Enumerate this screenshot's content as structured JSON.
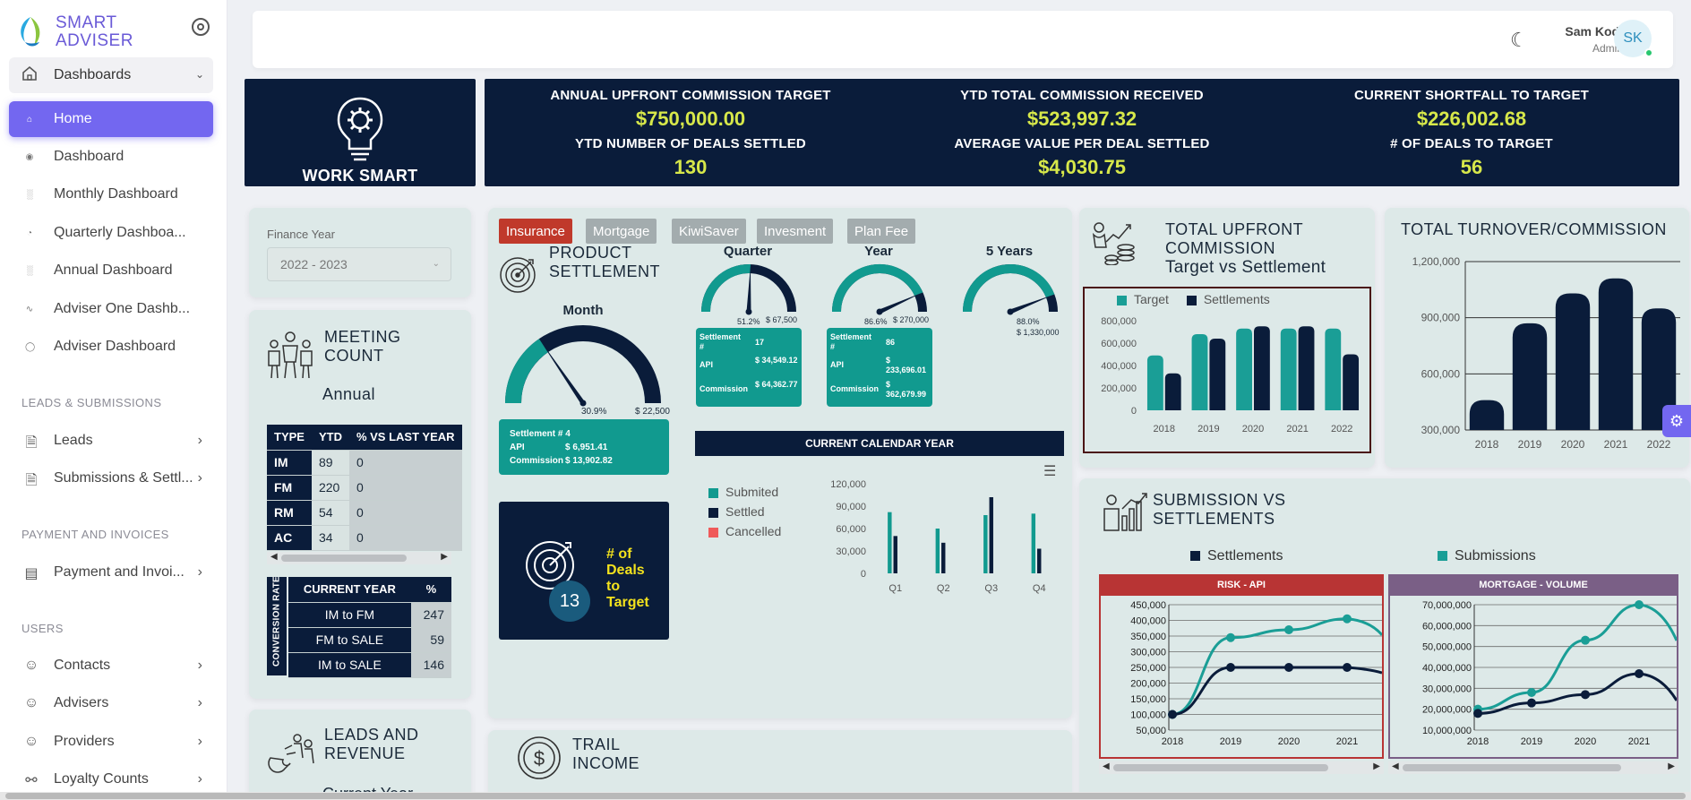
{
  "brand": {
    "line1": "SMART",
    "line2": "ADVISER"
  },
  "sidebar": {
    "group": "Dashboards",
    "items": [
      {
        "label": "Home"
      },
      {
        "label": "Dashboard"
      },
      {
        "label": "Monthly Dashboard"
      },
      {
        "label": "Quarterly Dashboa..."
      },
      {
        "label": "Annual Dashboard"
      },
      {
        "label": "Adviser One Dashb..."
      },
      {
        "label": "Adviser Dashboard"
      }
    ],
    "sections": {
      "leads": "LEADS & SUBMISSIONS",
      "payment": "PAYMENT AND INVOICES",
      "users": "USERS"
    },
    "leads_items": [
      "Leads",
      "Submissions & Settl..."
    ],
    "payment_items": [
      "Payment and Invoi..."
    ],
    "user_items": [
      "Contacts",
      "Advisers",
      "Providers",
      "Loyalty Counts"
    ]
  },
  "header": {
    "user_name": "Sam Kodi",
    "user_role": "Admin",
    "initials": "SK"
  },
  "work_smart": {
    "caption": "WORK SMART"
  },
  "kpis": [
    {
      "label": "ANNUAL UPFRONT COMMISSION TARGET",
      "value": "$750,000.00"
    },
    {
      "label": "YTD TOTAL COMMISSION RECEIVED",
      "value": "$523,997.32"
    },
    {
      "label": "CURRENT SHORTFALL TO TARGET",
      "value": "$226,002.68"
    },
    {
      "label": "YTD NUMBER OF DEALS SETTLED",
      "value": "130"
    },
    {
      "label": "AVERAGE VALUE PER DEAL SETTLED",
      "value": "$4,030.75"
    },
    {
      "label": "# OF DEALS TO TARGET",
      "value": "56"
    }
  ],
  "finance": {
    "label": "Finance Year",
    "value": "2022 - 2023"
  },
  "meeting": {
    "title_l1": "MEETING",
    "title_l2": "COUNT",
    "subtitle": "Annual",
    "headers": [
      "TYPE",
      "YTD",
      "% VS LAST YEAR"
    ],
    "rows": [
      [
        "IM",
        "89",
        "0"
      ],
      [
        "FM",
        "220",
        "0"
      ],
      [
        "RM",
        "54",
        "0"
      ],
      [
        "AC",
        "34",
        "0"
      ]
    ],
    "conv_label": "CONVERSION RATE",
    "conv_headers": [
      "CURRENT YEAR",
      "%"
    ],
    "conv_rows": [
      [
        "IM to FM",
        "247"
      ],
      [
        "FM to SALE",
        "59"
      ],
      [
        "IM to SALE",
        "146"
      ]
    ]
  },
  "leads_revenue": {
    "title_l1": "LEADS AND",
    "title_l2": "REVENUE",
    "subtitle": "Current Year"
  },
  "product": {
    "tabs": [
      "Insurance",
      "Mortgage",
      "KiwiSaver",
      "Invesment",
      "Plan Fee"
    ],
    "title_l1": "PRODUCT",
    "title_l2": "SETTLEMENT",
    "month": {
      "label": "Month",
      "pct": "30.9%",
      "target": "$ 22,500",
      "fraction": 0.309,
      "settlement": "Settlement # 4",
      "api_label": "API",
      "api": "$ 6,951.41",
      "comm_label": "Commission",
      "comm": "$ 13,902.82"
    },
    "quarter": {
      "label": "Quarter",
      "pct": "51.2%",
      "target": "$ 67,500",
      "fraction": 0.512,
      "settlement_label": "Settlement #",
      "settlement": "17",
      "api_label": "API",
      "api": "$ 34,549.12",
      "comm_label": "Commission",
      "comm": "$ 64,362.77"
    },
    "year": {
      "label": "Year",
      "pct": "86.6%",
      "target": "$ 270,000",
      "fraction": 0.866,
      "settlement_label": "Settlement #",
      "settlement": "86",
      "api_label": "API",
      "api": "$ 233,696.01",
      "comm_label": "Commission",
      "comm": "$ 362,679.99"
    },
    "five": {
      "label": "5 Years",
      "pct": "88.0%",
      "target": "$ 1,330,000",
      "fraction": 0.88
    },
    "deals": {
      "count": "13",
      "l1": "# of",
      "l2": "Deals",
      "l3": "to",
      "l4": "Target"
    },
    "calendar_title": "CURRENT CALENDAR YEAR",
    "calendar_legend": [
      "Submited",
      "Settled",
      "Cancelled"
    ]
  },
  "trail": {
    "title_l1": "TRAIL",
    "title_l2": "INCOME"
  },
  "upfront": {
    "title_l1": "TOTAL UPFRONT",
    "title_l2": "COMMISSION",
    "title_l3": "Target vs Settlement",
    "legend": [
      "Target",
      "Settlements"
    ]
  },
  "turnover": {
    "title": "TOTAL TURNOVER/COMMISSION"
  },
  "subs": {
    "title_l1": "SUBMISSION VS",
    "title_l2": "SETTLEMENTS",
    "legend": [
      "Settlements",
      "Submissions"
    ],
    "risk_title": "RISK - API",
    "mortgage_title": "MORTGAGE - VOLUME"
  },
  "colors": {
    "navy": "#0a1c3a",
    "teal": "#1a9e96",
    "accent": "#7367f0",
    "yellow": "#d7e84a",
    "red": "#c0392b",
    "purple": "#7a5f86"
  },
  "chart_data": [
    {
      "type": "bar",
      "title": "CURRENT CALENDAR YEAR",
      "categories": [
        "Q1",
        "Q2",
        "Q3",
        "Q4"
      ],
      "series": [
        {
          "name": "Submited",
          "values": [
            82000,
            60000,
            78000,
            80000
          ]
        },
        {
          "name": "Settled",
          "values": [
            50000,
            41000,
            102000,
            33000
          ]
        },
        {
          "name": "Cancelled",
          "values": [
            0,
            0,
            0,
            0
          ]
        }
      ],
      "ylim": [
        0,
        120000
      ],
      "yticks": [
        "120,000",
        "90,000",
        "60,000",
        "30,000",
        "0"
      ]
    },
    {
      "type": "bar",
      "title": "TOTAL UPFRONT COMMISSION Target vs Settlement",
      "categories": [
        "2018",
        "2019",
        "2020",
        "2021",
        "2022"
      ],
      "series": [
        {
          "name": "Target",
          "values": [
            490000,
            680000,
            730000,
            730000,
            730000
          ]
        },
        {
          "name": "Settlements",
          "values": [
            330000,
            640000,
            750000,
            750000,
            500000
          ]
        }
      ],
      "ylim": [
        0,
        800000
      ],
      "yticks": [
        "800,000",
        "600,000",
        "400,000",
        "200,000",
        "0"
      ]
    },
    {
      "type": "bar",
      "title": "TOTAL TURNOVER/COMMISSION",
      "categories": [
        "2018",
        "2019",
        "2020",
        "2021",
        "2022"
      ],
      "series": [
        {
          "name": "",
          "values": [
            460000,
            870000,
            1030000,
            1110000,
            950000
          ]
        }
      ],
      "ylim": [
        300000,
        1200000
      ],
      "yticks": [
        "1,200,000",
        "900,000",
        "600,000",
        "300,000"
      ]
    },
    {
      "type": "line",
      "title": "RISK - API",
      "x": [
        "2018",
        "2019",
        "2020",
        "2021"
      ],
      "series": [
        {
          "name": "Submissions",
          "values": [
            100000,
            345000,
            370000,
            405000
          ]
        },
        {
          "name": "Settlements",
          "values": [
            100000,
            250000,
            250000,
            250000
          ]
        }
      ],
      "ylim": [
        50000,
        450000
      ],
      "yticks": [
        "450,000",
        "400,000",
        "350,000",
        "300,000",
        "250,000",
        "200,000",
        "150,000",
        "100,000",
        "50,000"
      ]
    },
    {
      "type": "line",
      "title": "MORTGAGE - VOLUME",
      "x": [
        "2018",
        "2019",
        "2020",
        "2021"
      ],
      "series": [
        {
          "name": "Submissions",
          "values": [
            20000000,
            28000000,
            53000000,
            70000000
          ]
        },
        {
          "name": "Settlements",
          "values": [
            18000000,
            23000000,
            27000000,
            37000000
          ]
        }
      ],
      "ylim": [
        10000000,
        70000000
      ],
      "yticks": [
        "70,000,000",
        "60,000,000",
        "50,000,000",
        "40,000,000",
        "30,000,000",
        "20,000,000",
        "10,000,000"
      ]
    }
  ]
}
